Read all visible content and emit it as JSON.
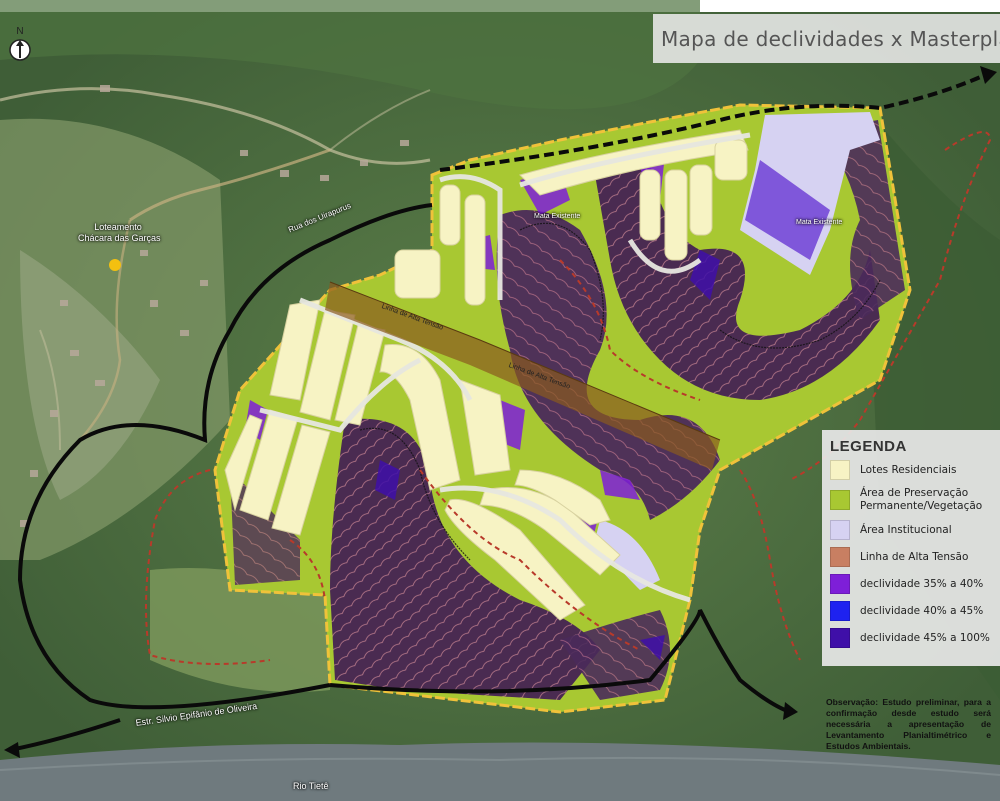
{
  "map": {
    "title": "Mapa de declividades x Masterplan",
    "north_label": "N",
    "place_labels": {
      "loteamento_line1": "Loteamento",
      "loteamento_line2": "Chácara das Garças",
      "rua": "Rua dos Uirapurus",
      "estrada": "Estr. Silvio Epifânio de Oliveira",
      "rio": "Rio Tietê",
      "linha1": "Linha de Alta Tensão",
      "linha2": "Linha de Alta Tensão",
      "mata1": "Mata Existente",
      "mata2": "Mata Existente"
    },
    "legend": {
      "title": "LEGENDA",
      "items": [
        {
          "label": "Lotes Residenciais",
          "color": "#f7f3c4"
        },
        {
          "label": "Área de Preservação Permanente/Vegetação",
          "color": "#a8c832"
        },
        {
          "label": "Área Institucional",
          "color": "#d6d2f2"
        },
        {
          "label": "Linha de Alta Tensão",
          "color": "#c87f62"
        },
        {
          "label": "declividade 35% a 40%",
          "color": "#7e1fd8"
        },
        {
          "label": "declividade 40% a 45%",
          "color": "#1e22f0"
        },
        {
          "label": "declividade 45% a 100%",
          "color": "#3f0fa8"
        }
      ]
    },
    "note": "Observação: Estudo preliminar, para a confirmação desde estudo será necessária a apresentação de Levantamento Planialtimétrico e Estudos Ambientais."
  }
}
